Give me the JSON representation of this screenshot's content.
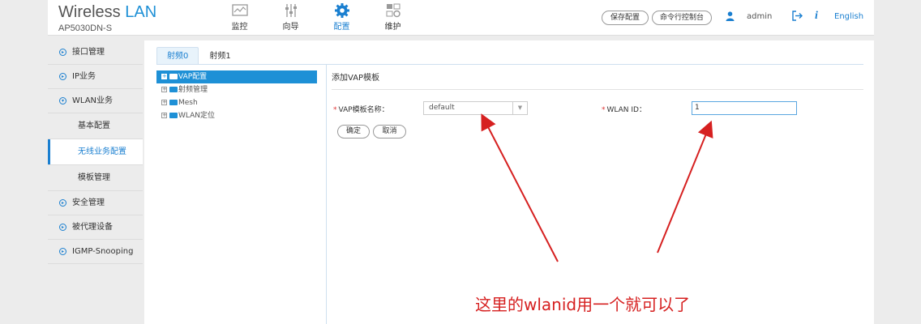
{
  "header": {
    "title_main": "Wireless",
    "title_accent": "LAN",
    "model": "AP5030DN-S",
    "nav": [
      {
        "label": "监控",
        "icon": "monitor-icon"
      },
      {
        "label": "向导",
        "icon": "wizard-icon"
      },
      {
        "label": "配置",
        "icon": "config-gear-icon"
      },
      {
        "label": "维护",
        "icon": "maintain-icon"
      }
    ],
    "save_button": "保存配置",
    "cli_button": "命令行控制台",
    "user": "admin",
    "language": "English",
    "accent_color": "#1a7fd0"
  },
  "sidebar": {
    "items": [
      {
        "label": "接口管理"
      },
      {
        "label": "IP业务"
      },
      {
        "label": "WLAN业务"
      }
    ],
    "sub_items": [
      {
        "label": "基本配置"
      },
      {
        "label": "无线业务配置"
      },
      {
        "label": "模板管理"
      }
    ],
    "items_after": [
      {
        "label": "安全管理"
      },
      {
        "label": "被代理设备"
      },
      {
        "label": "IGMP-Snooping"
      }
    ]
  },
  "main": {
    "tabs": [
      {
        "label": "射频0"
      },
      {
        "label": "射频1"
      }
    ],
    "tree": [
      {
        "label": "VAP配置"
      },
      {
        "label": "射频管理"
      },
      {
        "label": "Mesh"
      },
      {
        "label": "WLAN定位"
      }
    ],
    "panel_title": "添加VAP模板",
    "vap_label": "VAP模板名称：",
    "vap_value": "default",
    "wlan_id_label": "WLAN ID：",
    "wlan_id_value": "1",
    "ok_button": "确定",
    "cancel_button": "取消"
  },
  "annotation": {
    "text": "这里的wlanid用一个就可以了",
    "color": "#d62020"
  }
}
